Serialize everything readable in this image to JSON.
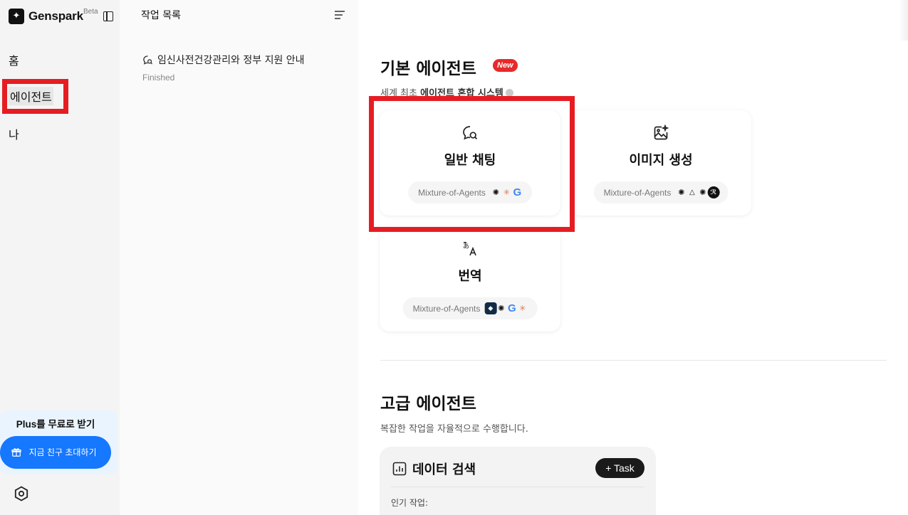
{
  "nav": {
    "brand": "Genspark",
    "beta": "Beta",
    "items": [
      {
        "label": "홈"
      },
      {
        "label": "에이전트"
      },
      {
        "label": "나"
      }
    ],
    "promo": {
      "title": "Plus를 무료로 받기",
      "invite": "지금 친구 초대하기"
    }
  },
  "task_panel": {
    "title": "작업 목록",
    "tasks": [
      {
        "title": "임신사전건강관리와 정부 지원 안내",
        "status": "Finished"
      }
    ]
  },
  "basic": {
    "title": "기본 에이전트",
    "badge": "New",
    "subtitle_prefix": "세계 최초 ",
    "subtitle_bold": "에이전트 혼합 시스템",
    "cards": [
      {
        "title": "일반 채팅",
        "pill": "Mixture-of-Agents",
        "icon": "chat-search-icon"
      },
      {
        "title": "이미지 생성",
        "pill": "Mixture-of-Agents",
        "icon": "image-sparkle-icon"
      },
      {
        "title": "번역",
        "pill": "Mixture-of-Agents",
        "icon": "translate-icon"
      }
    ]
  },
  "advanced": {
    "title": "고급 에이전트",
    "subtitle": "복잡한 작업을 자율적으로 수행합니다.",
    "task_card": {
      "title": "데이터 검색",
      "button": "+ Task",
      "popular_label": "인기 작업:"
    }
  },
  "colors": {
    "accent_blue": "#1677ff",
    "highlight_red": "#e51d23",
    "new_badge": "#e72a2a"
  }
}
